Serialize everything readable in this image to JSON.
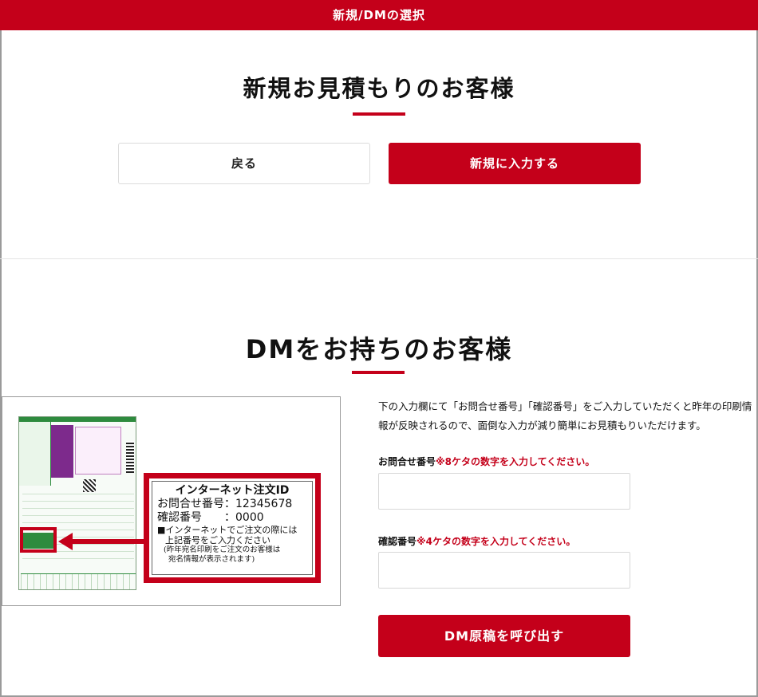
{
  "header": {
    "title": "新規/DMの選択"
  },
  "new_section": {
    "title": "新規お見積もりのお客様",
    "back_label": "戻る",
    "new_label": "新規に入力する"
  },
  "dm_section": {
    "title": "DMをお持ちのお客様",
    "description": "下の入力欄にて「お問合せ番号」「確認番号」をご入力していただくと昨年の印刷情報が反映されるので、面倒な入力が減り簡単にお見積もりいただけます。",
    "inquiry_label": "お問合せ番号",
    "inquiry_note": "※8ケタの数字を入力してください。",
    "inquiry_value": "",
    "confirm_label": "確認番号",
    "confirm_note": "※4ケタの数字を入力してください。",
    "confirm_value": "",
    "submit_label": "DM原稿を呼び出す",
    "image": {
      "callout_title": "インターネット注文ID",
      "callout_inquiry": "お問合せ番号：12345678",
      "callout_confirm": "確認番号　　：0000",
      "callout_note1": "■インターネットでご注文の際には",
      "callout_note2": "上記番号をご入力ください",
      "callout_note3": "(昨年宛名印刷をご注文のお客様は",
      "callout_note4": "宛名情報が表示されます)"
    }
  },
  "colors": {
    "accent": "#c4001a"
  }
}
